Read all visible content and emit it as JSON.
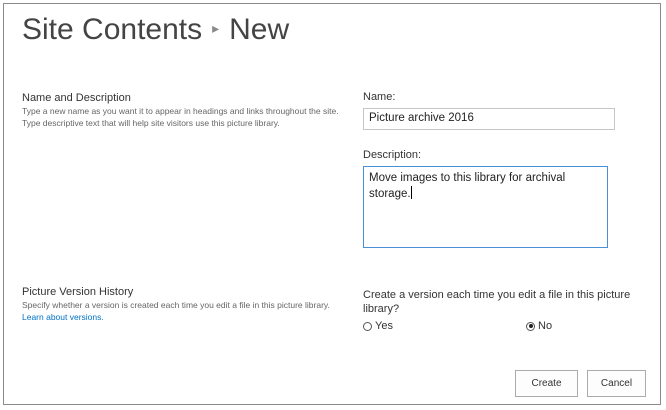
{
  "header": {
    "breadcrumb_parent": "Site Contents",
    "separator": "▸",
    "page_title": "New"
  },
  "name_section": {
    "heading": "Name and Description",
    "description": "Type a new name as you want it to appear in headings and links throughout the site. Type descriptive text that will help site visitors use this picture library.",
    "name_label": "Name:",
    "name_value": "Picture archive 2016",
    "description_label": "Description:",
    "description_value": "Move images to this library for archival storage."
  },
  "version_section": {
    "heading": "Picture Version History",
    "description": "Specify whether a version is created each time you edit a file in this picture library.",
    "learn_link": "Learn about versions.",
    "question": "Create a version each time you edit a file in this picture library?",
    "options": [
      {
        "label": "Yes",
        "selected": false
      },
      {
        "label": "No",
        "selected": true
      }
    ]
  },
  "actions": {
    "create_label": "Create",
    "cancel_label": "Cancel"
  }
}
